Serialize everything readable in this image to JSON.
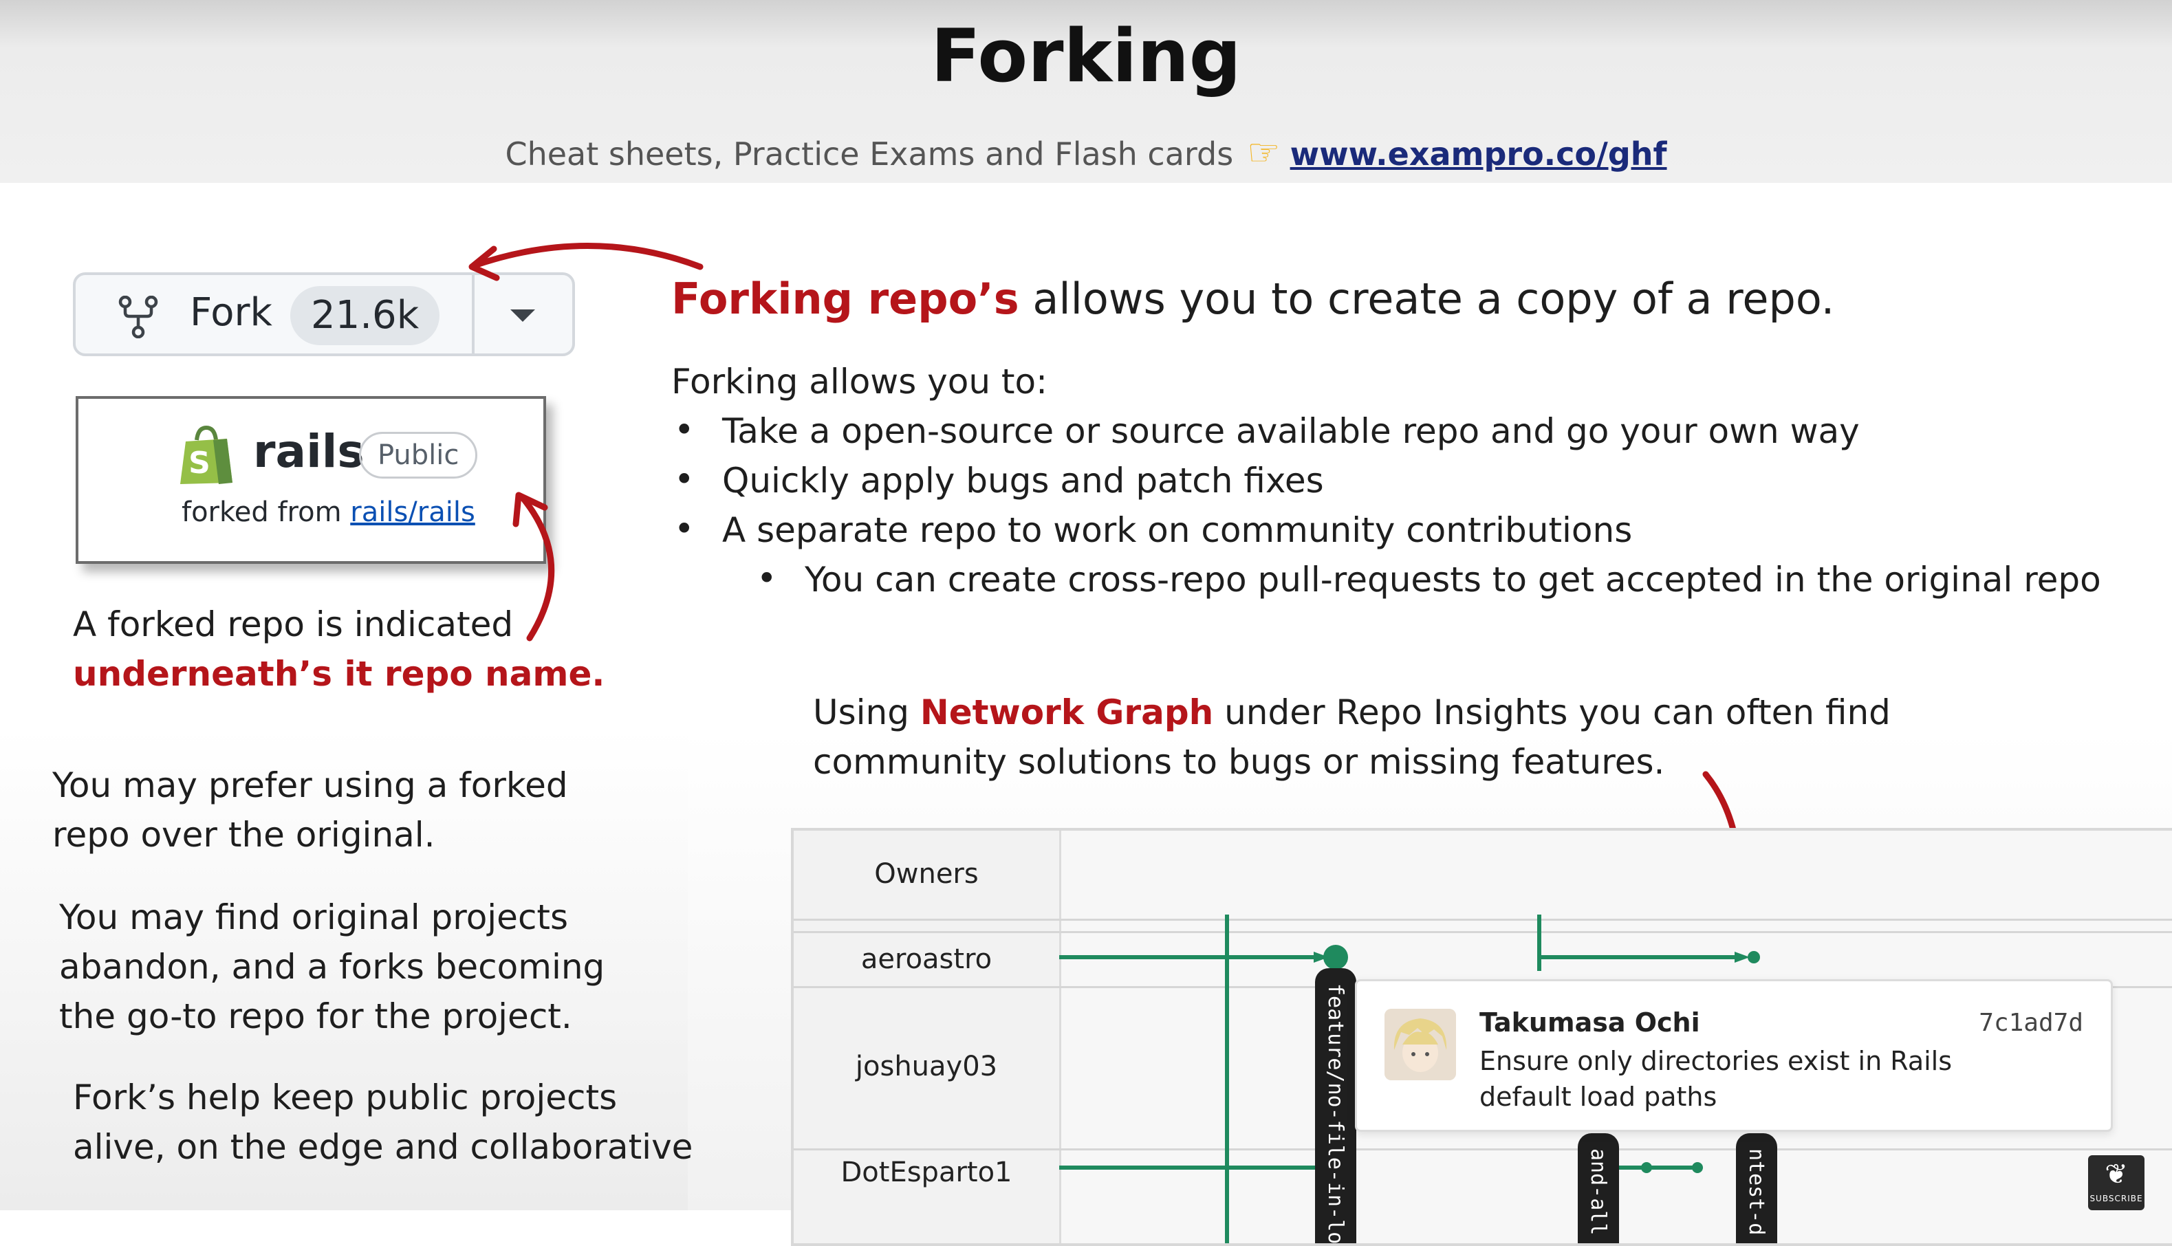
{
  "header": {
    "title": "Forking",
    "subtitle_text": "Cheat sheets, Practice Exams and Flash cards",
    "subtitle_icon": "pointing-hand-icon",
    "link_text": "www.exampro.co/ghf"
  },
  "fork_button": {
    "icon": "fork-icon",
    "label": "Fork",
    "count": "21.6k",
    "dropdown_icon": "caret-down-icon"
  },
  "rails_card": {
    "logo": "shopify-bag-logo",
    "name": "rails",
    "badge": "Public",
    "forked_from_prefix": "forked from",
    "forked_from_link": "rails/rails"
  },
  "forked_caption": {
    "line1": "A forked repo is indicated",
    "line2": "underneath’s it repo name."
  },
  "left_paragraphs": {
    "p1_line1": "You may prefer using a forked",
    "p1_line2": "repo over the original.",
    "p2_line1": "You may find original projects",
    "p2_line2": "abandon, and a forks becoming",
    "p2_line3": "the go-to repo for the project.",
    "p3_line1": "Fork’s help keep public projects",
    "p3_line2": "alive, on the edge and collaborative"
  },
  "headline": {
    "red": "Forking repo’s",
    "rest": " allows you to create a copy of a repo."
  },
  "forking_list": {
    "intro": "Forking allows you to:",
    "bullet_char": "•",
    "items": [
      "Take a open-source or source available repo and go your own way",
      "Quickly apply bugs and patch fixes",
      "A separate repo to work on community contributions"
    ],
    "sub_item": "You can create cross-repo pull-requests to get accepted in the original repo"
  },
  "network_text": {
    "prefix": "Using ",
    "red": "Network Graph",
    "line1_rest": " under Repo Insights you can often find",
    "line2": "community solutions to bugs or missing features."
  },
  "network_graph": {
    "owners_header": "Owners",
    "owners": [
      "aeroastro",
      "joshuay03",
      "DotEsparto1"
    ],
    "branch_labels": [
      "feature/no-file-in-load",
      "and-all",
      "ntest-d"
    ],
    "line_color": "#1f8a5e"
  },
  "commit_tooltip": {
    "author": "Takumasa Ochi",
    "hash": "7c1ad7d",
    "message": "Ensure only directories exist in Rails default load paths",
    "avatar": "anime-avatar"
  },
  "subscribe_badge": {
    "icon": "freecodecamp-flame-icon",
    "label": "SUBSCRIBE"
  },
  "colors": {
    "accent_red": "#b5151a",
    "link_blue": "#0b50b3",
    "graph_green": "#1f8a5e"
  }
}
